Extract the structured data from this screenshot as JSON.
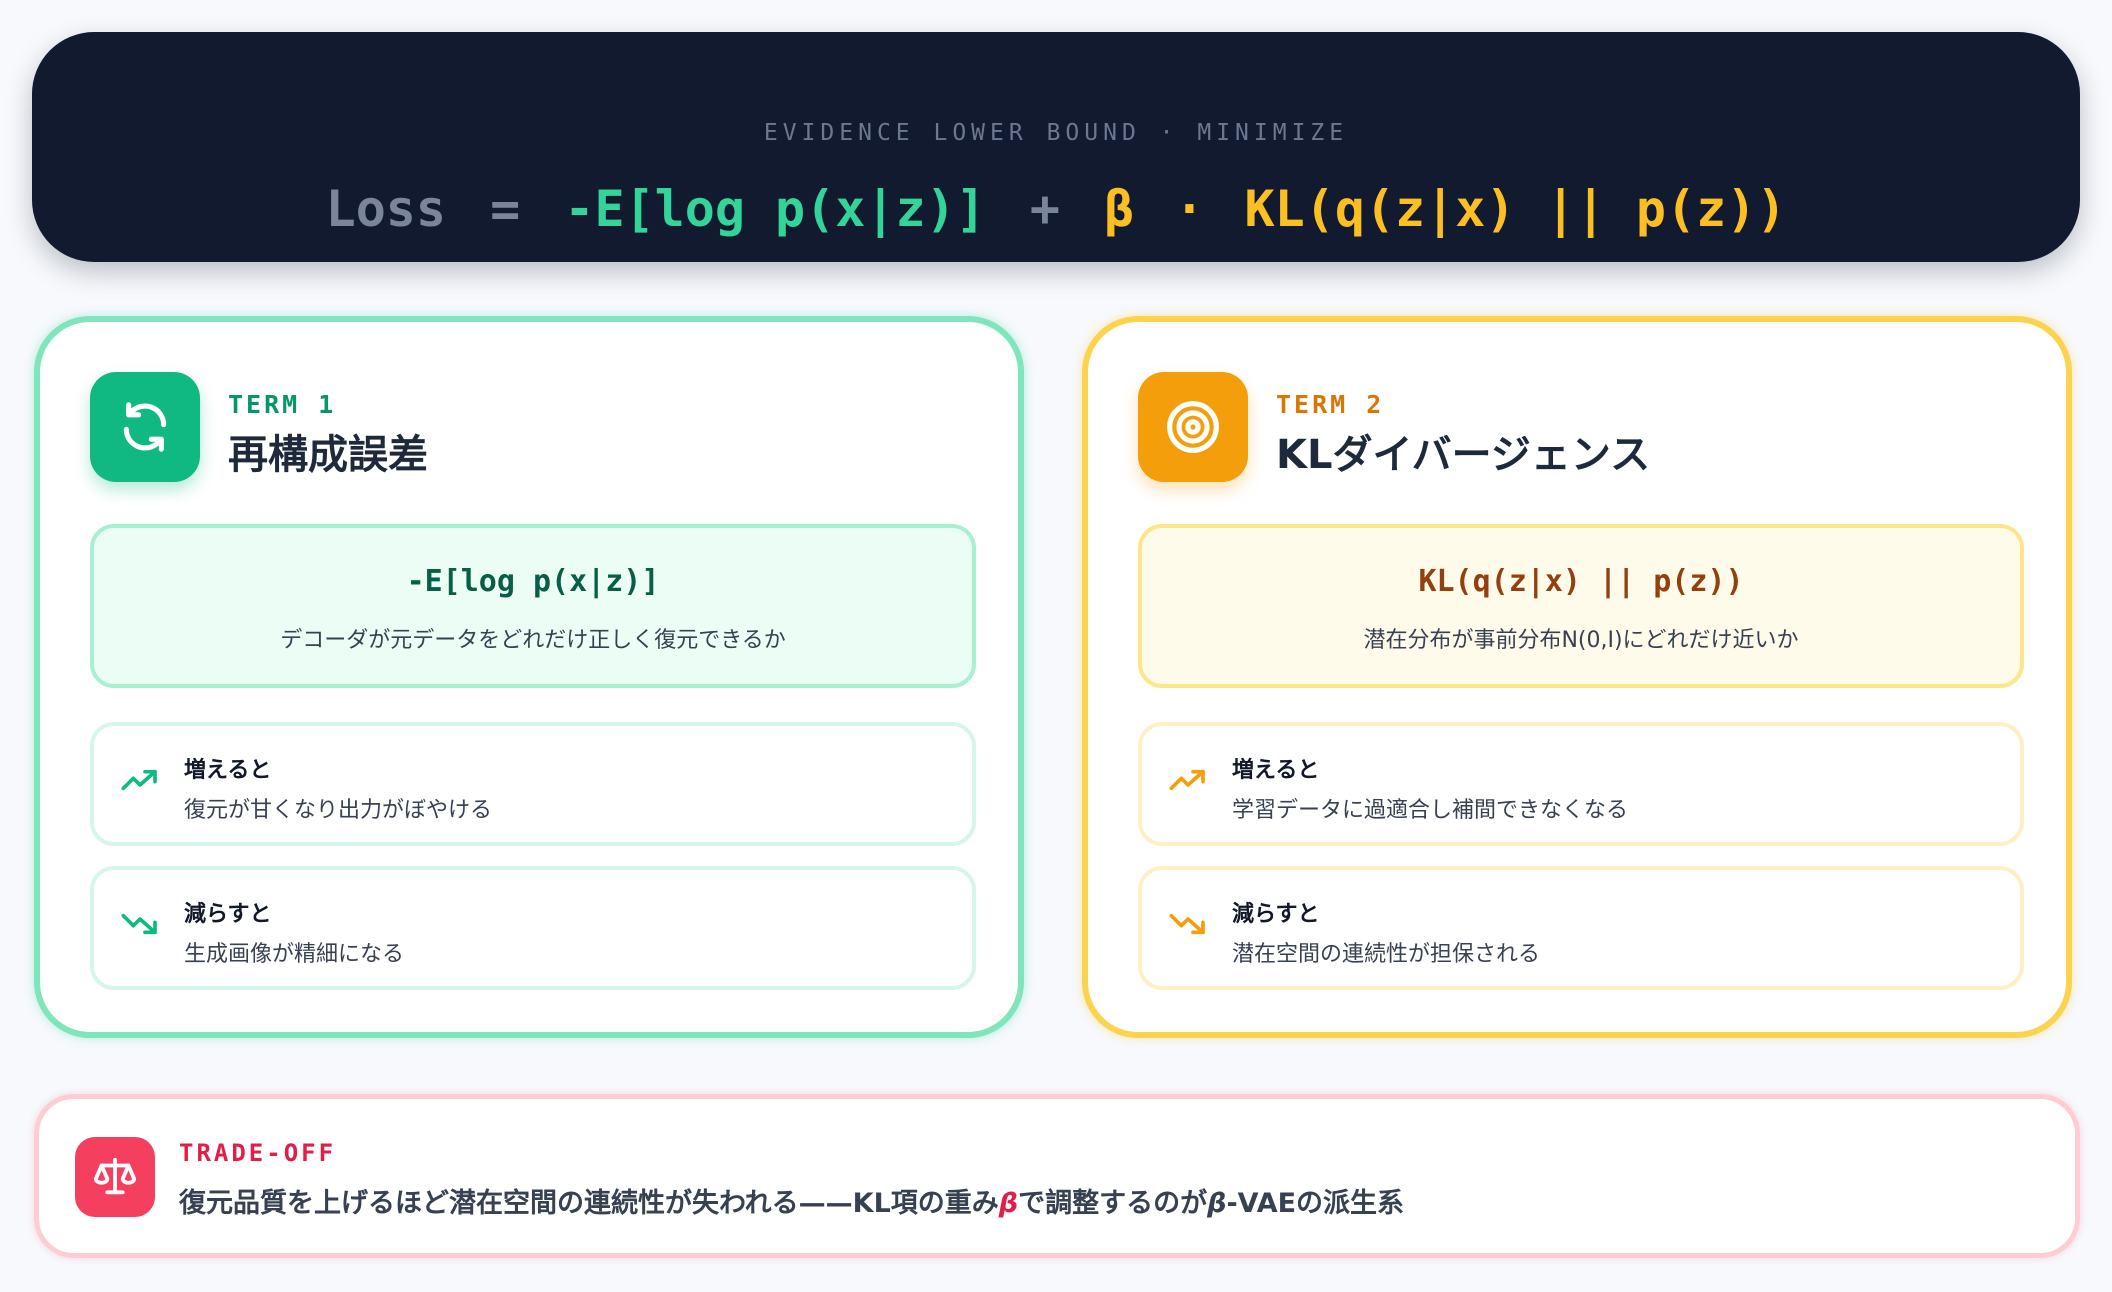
{
  "header": {
    "caption": "EVIDENCE LOWER BOUND · MINIMIZE",
    "formula": {
      "lhs": "Loss",
      "eq": "=",
      "recon": "-E[log p(x|z)]",
      "plus": "+",
      "beta": "β",
      "dot": "·",
      "kl": "KL(q(z|x) || p(z))"
    }
  },
  "terms": [
    {
      "label": "TERM 1",
      "title": "再構成誤差",
      "icon": "refresh-icon",
      "color": "#10b981",
      "expr": "-E[log p(x|z)]",
      "description": "デコーダが元データをどれだけ正しく復元できるか",
      "increase": {
        "heading": "増えると",
        "text": "復元が甘くなり出力がぼやける"
      },
      "decrease": {
        "heading": "減らすと",
        "text": "生成画像が精細になる"
      }
    },
    {
      "label": "TERM 2",
      "title": "KLダイバージェンス",
      "icon": "target-icon",
      "color": "#f59e0b",
      "expr": "KL(q(z|x) || p(z))",
      "description": "潜在分布が事前分布N(0,I)にどれだけ近いか",
      "increase": {
        "heading": "増えると",
        "text": "学習データに過適合し補間できなくなる"
      },
      "decrease": {
        "heading": "減らすと",
        "text": "潜在空間の連続性が担保される"
      }
    }
  ],
  "tradeoff": {
    "label": "TRADE-OFF",
    "icon": "scale-icon",
    "color": "#f43f5e",
    "text_before": "復元品質を上げるほど潜在空間の連続性が失われる——KL項の重み",
    "beta": "β",
    "text_middle": "で調整するのが",
    "beta2": "β",
    "text_after": "-VAEの派生系"
  }
}
